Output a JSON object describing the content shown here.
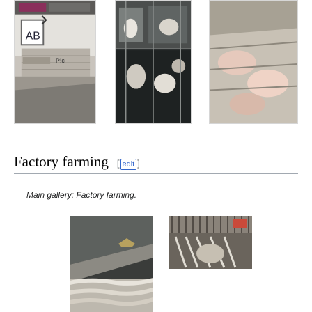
{
  "section": {
    "title": "Factory farming",
    "edit_bracket_open": "[",
    "edit_label": "edit",
    "edit_bracket_close": "]"
  },
  "hatnote": {
    "prefix": "Main gallery: ",
    "link": "Factory farming."
  },
  "top_gallery": {
    "thumb1_sign": "AB",
    "thumb1_small": "P!c"
  },
  "colors": {
    "link": "#3366cc",
    "heading_rule": "#a2a9b1"
  }
}
